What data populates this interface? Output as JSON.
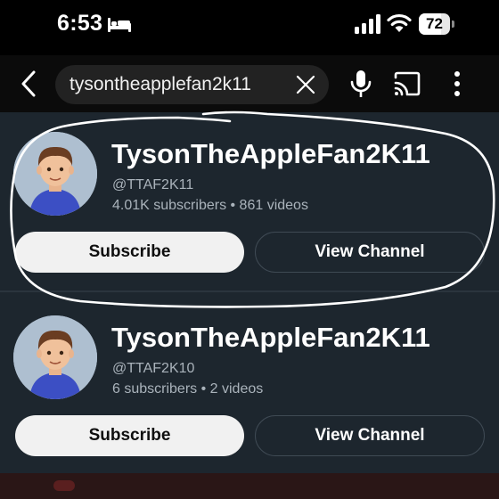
{
  "status_bar": {
    "time": "6:53",
    "focus_icon": "bed-icon",
    "battery_level": "72",
    "battery_fraction": 0.72
  },
  "app_bar": {
    "back_icon": "chevron-left-icon",
    "search_query": "tysontheapplefan2k11",
    "clear_icon": "close-icon",
    "mic_icon": "microphone-icon",
    "cast_icon": "cast-icon",
    "more_icon": "more-vertical-icon"
  },
  "results": [
    {
      "channel_name": "TysonTheAppleFan2K11",
      "handle": "@TTAF2K11",
      "stats": "4.01K subscribers • 861 videos",
      "subscribe_label": "Subscribe",
      "view_channel_label": "View Channel",
      "circled": true
    },
    {
      "channel_name": "TysonTheAppleFan2K11",
      "handle": "@TTAF2K10",
      "stats": "6 subscribers • 2 videos",
      "subscribe_label": "Subscribe",
      "view_channel_label": "View Channel",
      "circled": false
    }
  ],
  "colors": {
    "background": "#1d262e",
    "subscribe_bg": "#f1f1f1",
    "annotation_stroke": "#ffffff"
  }
}
